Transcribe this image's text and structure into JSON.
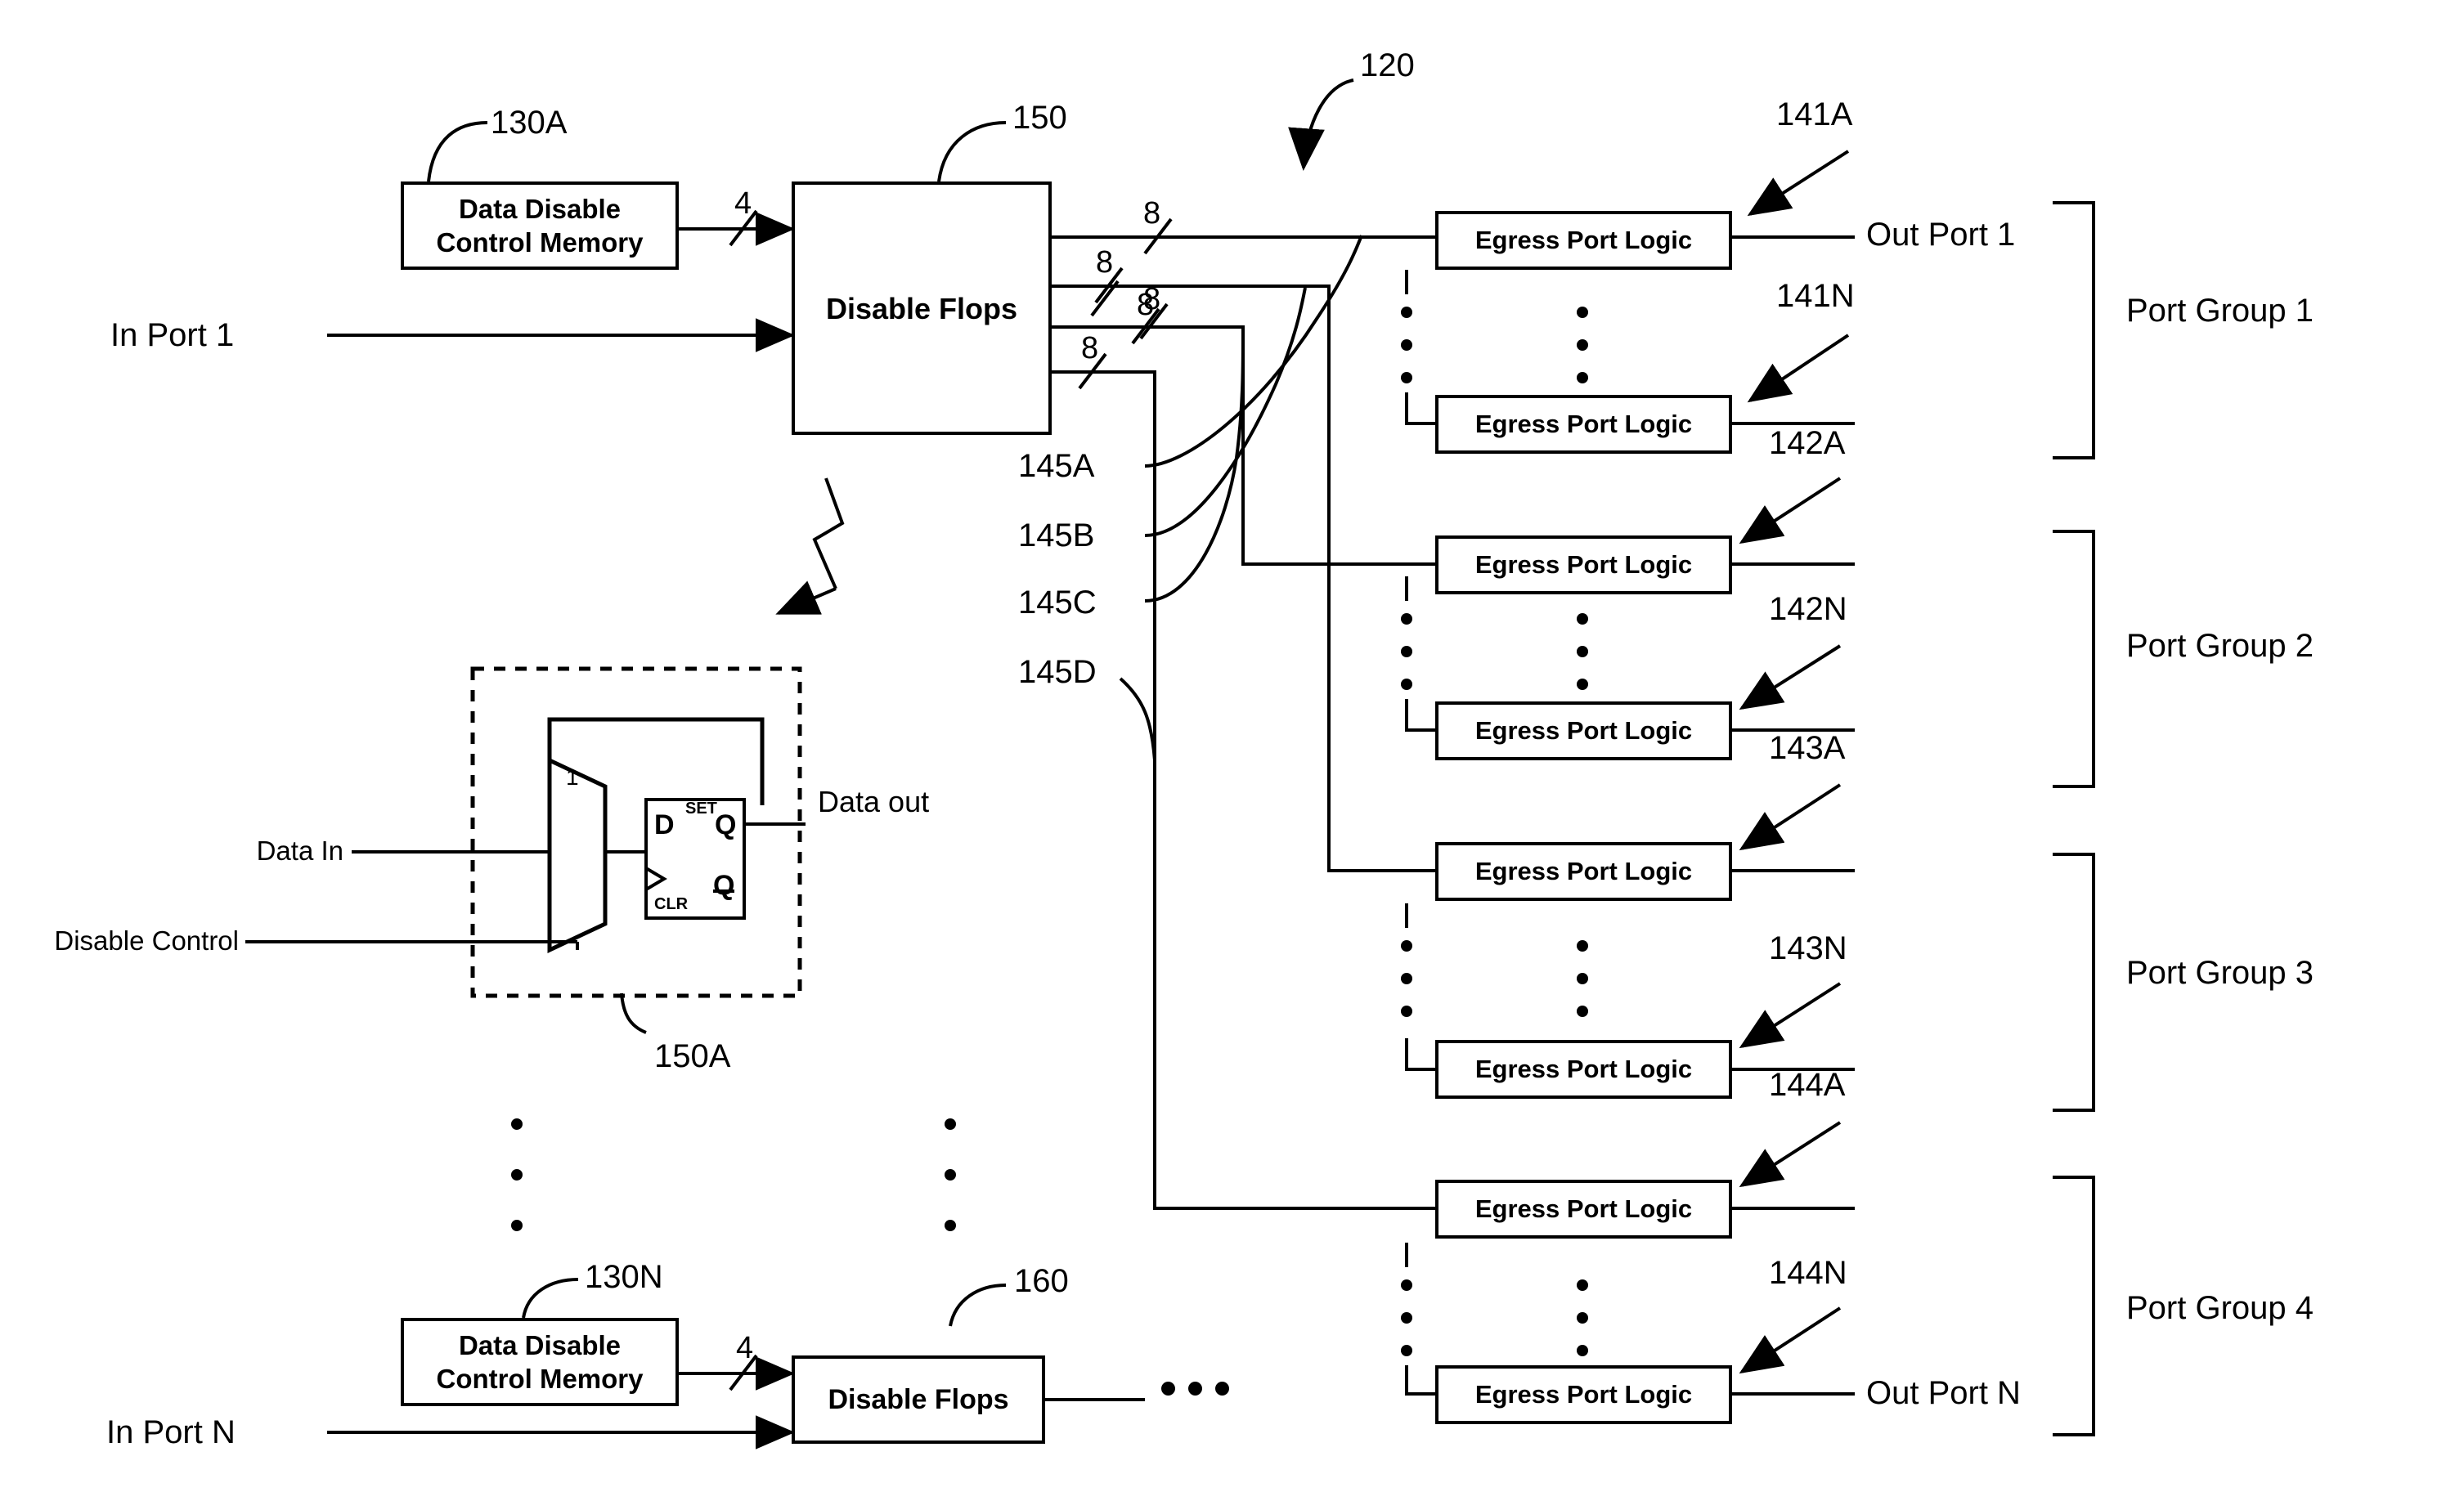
{
  "figure": {
    "reference_numerals": {
      "system": "120",
      "disable_flops_top": "150",
      "disable_flops_bottom": "160",
      "control_memory_top": "130A",
      "control_memory_bottom": "130N",
      "flop_detail": "150A",
      "bus_a": "145A",
      "bus_b": "145B",
      "bus_c": "145C",
      "bus_d": "145D",
      "egress_141a": "141A",
      "egress_141n": "141N",
      "egress_142a": "142A",
      "egress_142n": "142N",
      "egress_143a": "143A",
      "egress_143n": "143N",
      "egress_144a": "144A",
      "egress_144n": "144N"
    },
    "blocks": {
      "control_memory": "Data Disable\nControl Memory",
      "disable_flops": "Disable Flops",
      "egress_port_logic": "Egress Port Logic"
    },
    "inputs": {
      "in_port_1": "In Port 1",
      "in_port_n": "In Port N"
    },
    "outputs": {
      "out_port_1": "Out Port 1",
      "out_port_n": "Out Port N"
    },
    "port_groups": [
      "Port Group 1",
      "Port Group 2",
      "Port Group 3",
      "Port Group 4"
    ],
    "bus_widths": {
      "mem_to_flops_top": "4",
      "in_port_1_width": "8",
      "mem_to_flops_bottom": "4",
      "out_bus_1": "8",
      "out_bus_2": "8",
      "out_bus_3": "8",
      "out_bus_4": "8"
    },
    "flop_detail": {
      "data_in": "Data In",
      "disable_control": "Disable Control",
      "data_out": "Data out",
      "mux_select": "1",
      "d_pin": "D",
      "q_pin": "Q",
      "qbar_pin": "Q",
      "set_pin": "SET",
      "clr_pin": "CLR"
    }
  }
}
